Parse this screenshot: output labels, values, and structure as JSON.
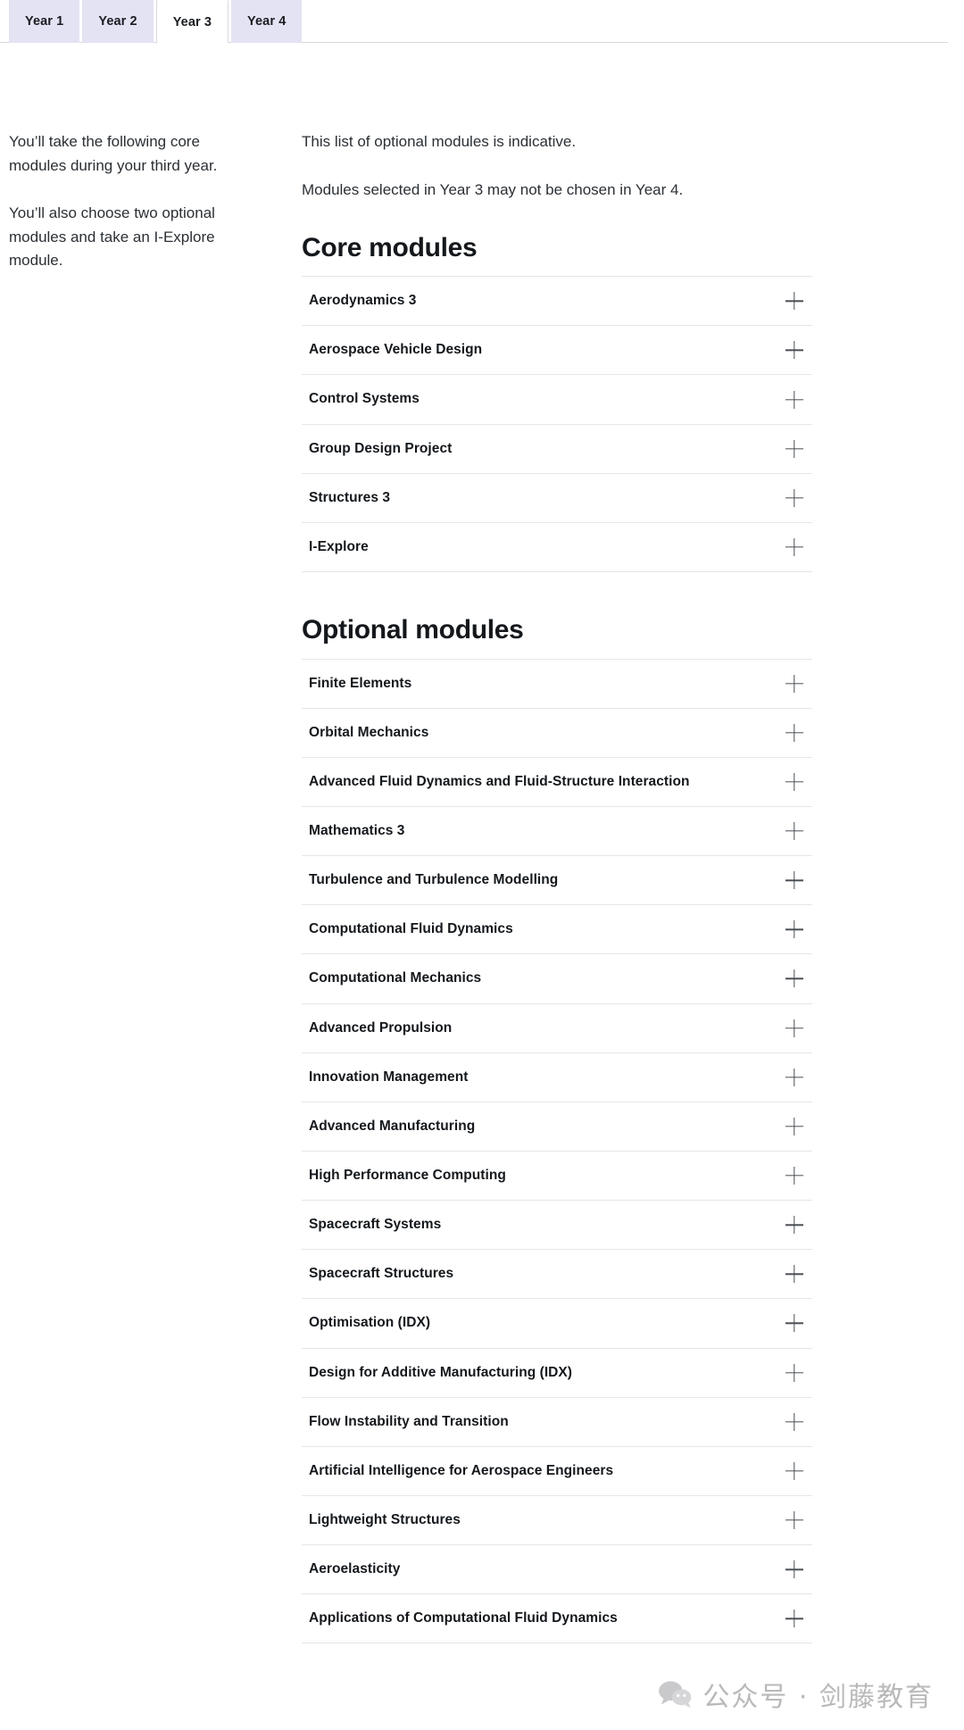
{
  "tabs": {
    "items": [
      {
        "label": "Year 1",
        "active": false
      },
      {
        "label": "Year 2",
        "active": false
      },
      {
        "label": "Year 3",
        "active": true
      },
      {
        "label": "Year 4",
        "active": false
      }
    ]
  },
  "left_column": {
    "paragraph_1": "You’ll take the following core modules during your third year.",
    "paragraph_2": "You’ll also choose two optional modules and take an I-Explore module."
  },
  "right_column": {
    "intro_1": "This list of optional modules is indicative.",
    "intro_2": "Modules selected in Year 3 may not be chosen in Year 4.",
    "core_heading": "Core modules",
    "optional_heading": "Optional modules",
    "core_modules": [
      "Aerodynamics 3",
      "Aerospace Vehicle Design",
      "Control Systems",
      "Group Design Project",
      "Structures 3",
      "I-Explore"
    ],
    "optional_modules": [
      "Finite Elements",
      "Orbital Mechanics",
      "Advanced Fluid Dynamics and Fluid-Structure Interaction",
      "Mathematics 3",
      "Turbulence and Turbulence Modelling",
      "Computational Fluid Dynamics",
      "Computational Mechanics",
      "Advanced Propulsion",
      "Innovation Management",
      "Advanced Manufacturing",
      "High Performance Computing",
      "Spacecraft Systems",
      "Spacecraft Structures",
      "Optimisation (IDX)",
      "Design for Additive Manufacturing (IDX)",
      "Flow Instability and Transition",
      "Artificial Intelligence for Aerospace Engineers",
      "Lightweight Structures",
      "Aeroelasticity",
      "Applications of Computational Fluid Dynamics"
    ],
    "expand_icon": "plus-icon"
  },
  "watermark": {
    "text": "公众号 · 剑藤教育",
    "icon": "wechat-icon",
    "color": "#b9b9bb"
  },
  "theme": {
    "tab_inactive_bg": "#e3e3f3",
    "tab_active_bg": "#ffffff",
    "divider": "#e4e6eb",
    "text": "#14181c",
    "body_text": "#2b3035"
  }
}
